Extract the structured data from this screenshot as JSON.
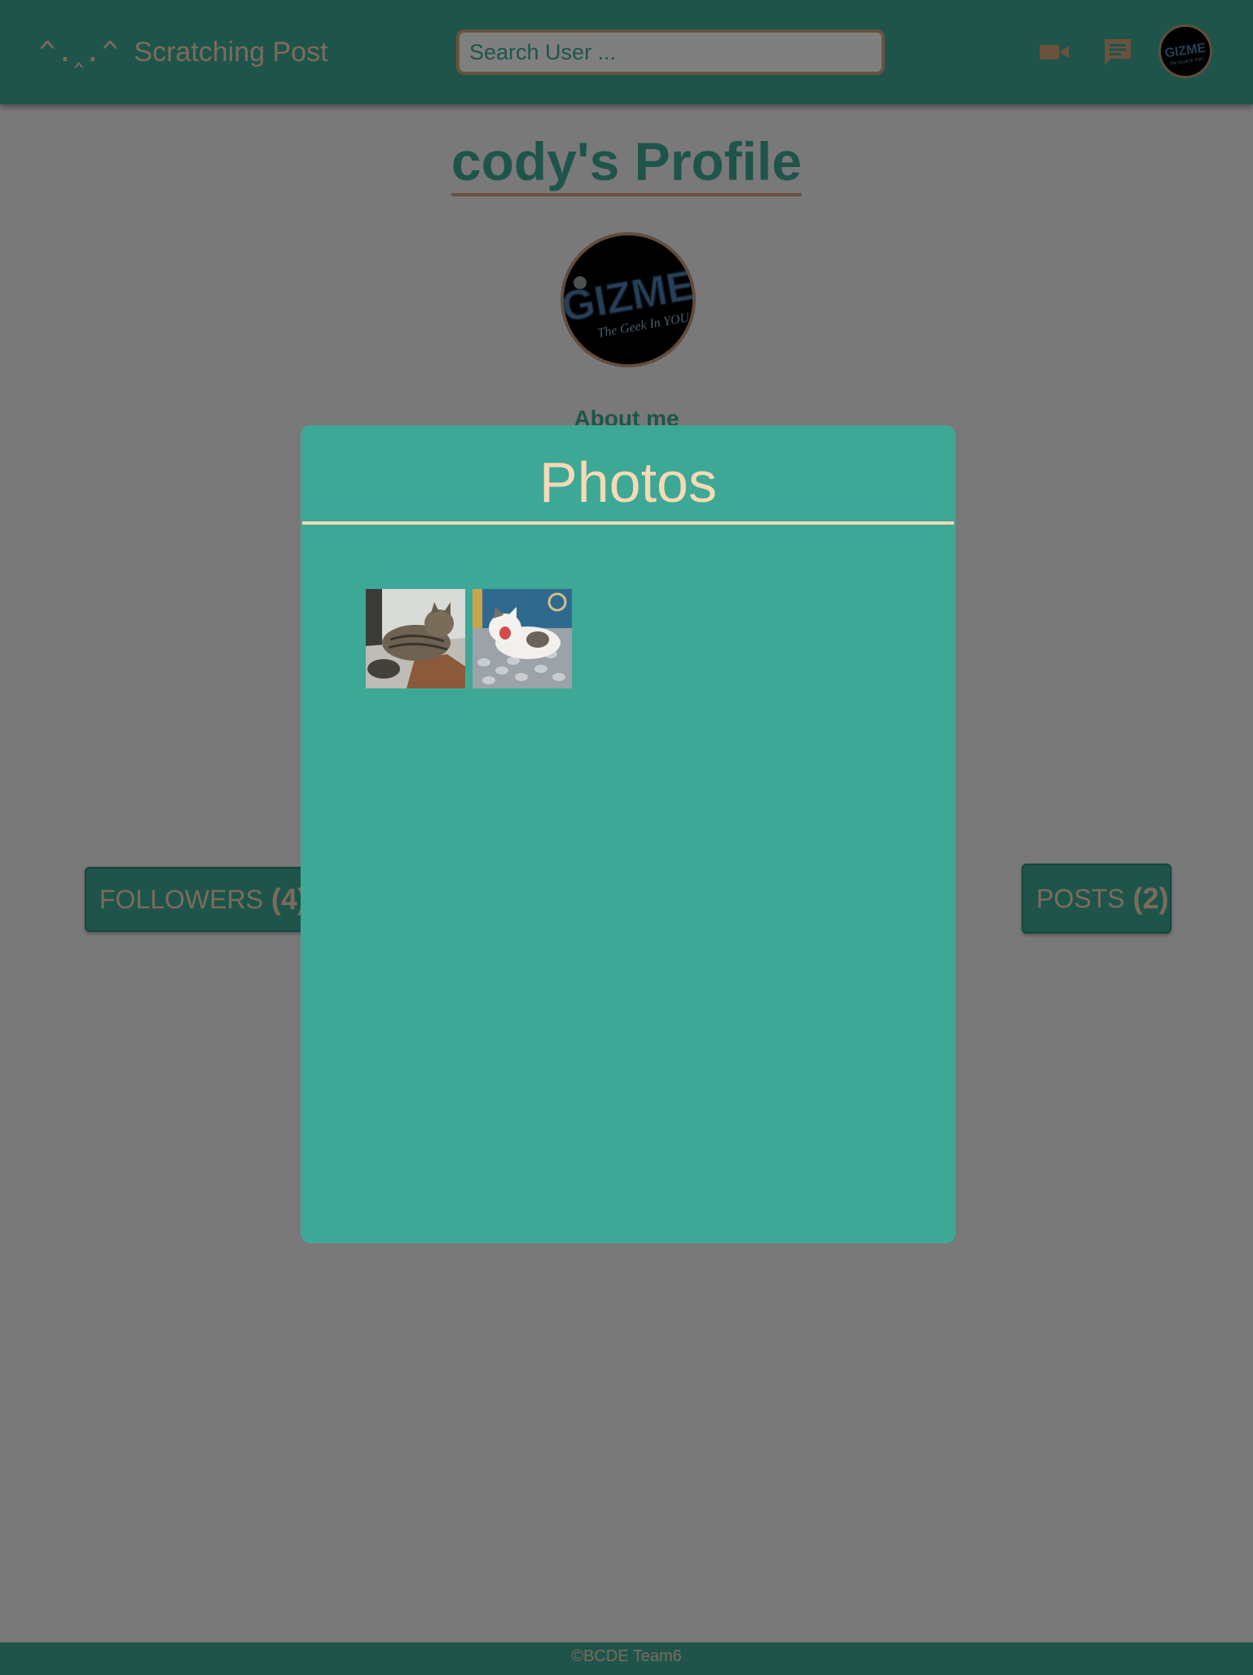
{
  "header": {
    "logo_text": "^.‸.^",
    "app_name": "Scratching Post",
    "search_placeholder": "Search User ...",
    "icons": [
      "video-camera-icon",
      "chat-icon"
    ]
  },
  "profile": {
    "title": "cody's Profile",
    "about_heading": "About me",
    "followers_label": "FOLLOWERS",
    "followers_count": "(4)",
    "posts_label": "POSTS",
    "posts_count": "(2)"
  },
  "modal": {
    "title": "Photos",
    "photos": [
      "tabby-cat-photo",
      "white-cat-yawning-photo"
    ]
  },
  "footer": {
    "text": "©BCDE Team6"
  },
  "colors": {
    "primary": "#3ea896",
    "accent": "#d2a77c",
    "text_light": "#f6d9b6",
    "overlay": "rgba(0,0,0,0.5)"
  }
}
